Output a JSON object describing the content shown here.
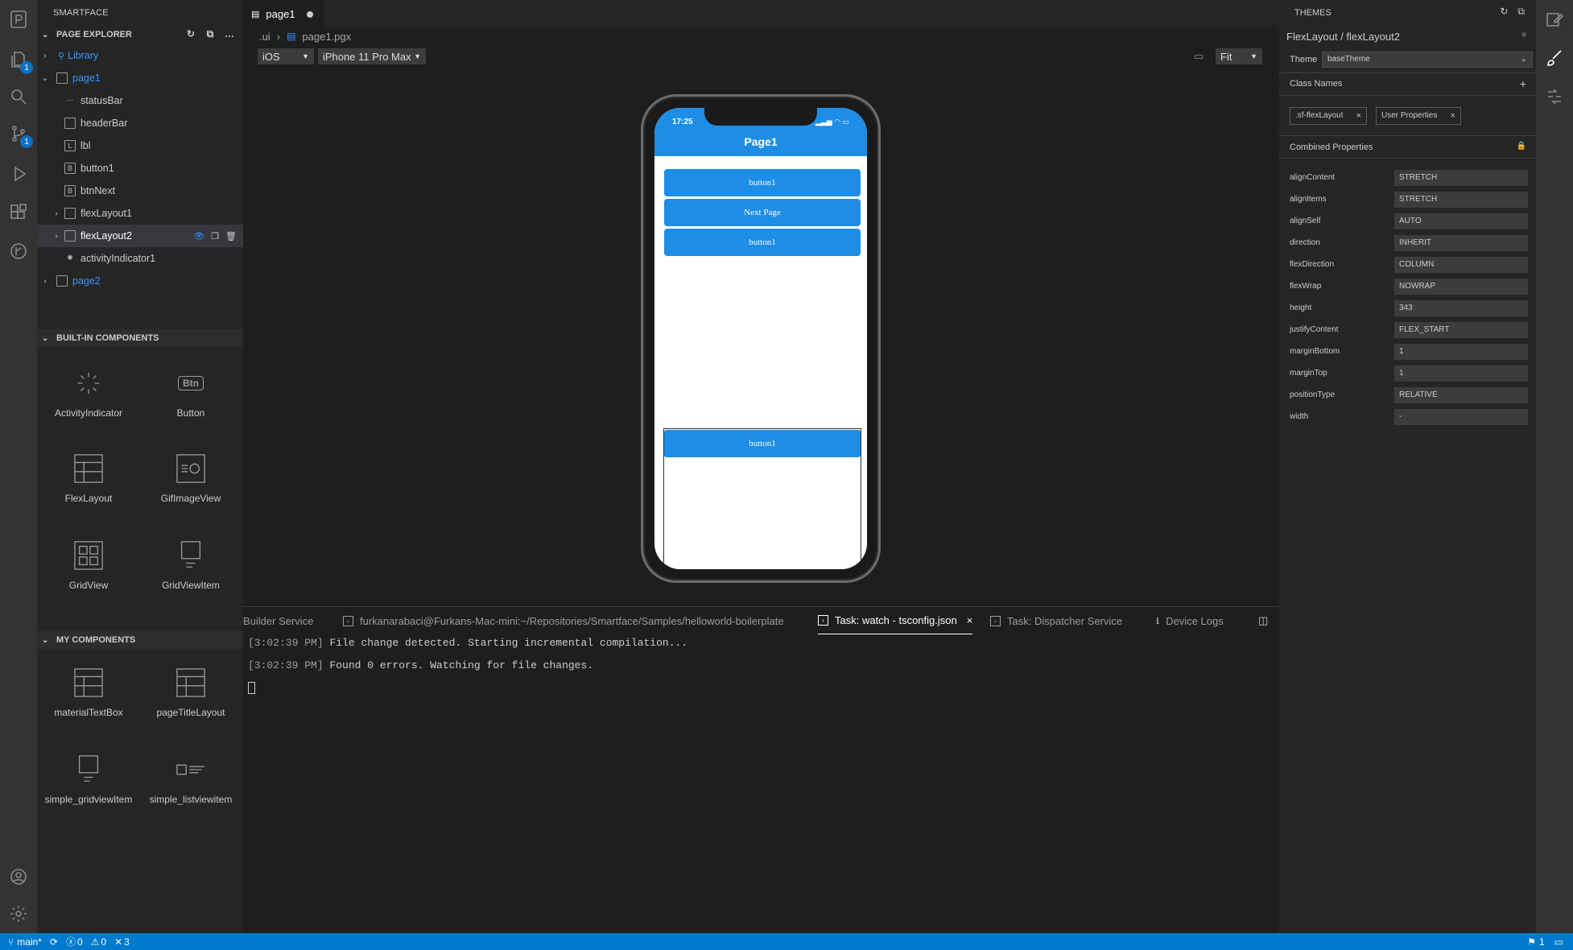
{
  "activity_bar": {
    "explorer_badge": "1",
    "scm_badge": "1"
  },
  "sidebar": {
    "title": "SMARTFACE",
    "page_explorer": {
      "header": "PAGE EXPLORER",
      "items": [
        {
          "label": "Library"
        },
        {
          "label": "page1"
        },
        {
          "label": "statusBar"
        },
        {
          "label": "headerBar"
        },
        {
          "label": "lbl"
        },
        {
          "label": "button1"
        },
        {
          "label": "btnNext"
        },
        {
          "label": "flexLayout1"
        },
        {
          "label": "flexLayout2"
        },
        {
          "label": "activityIndicator1"
        },
        {
          "label": "page2"
        }
      ]
    },
    "builtin": {
      "header": "BUILT-IN COMPONENTS",
      "items": [
        "ActivityIndicator",
        "Button",
        "FlexLayout",
        "GifImageView",
        "GridView",
        "GridViewItem"
      ],
      "btn_icon_text": "Btn"
    },
    "my_components": {
      "header": "MY COMPONENTS",
      "items": [
        "materialTextBox",
        "pageTitleLayout",
        "simple_gridviewItem",
        "simple_listviewitem"
      ]
    }
  },
  "editor": {
    "tab_label": "page1",
    "breadcrumb": [
      ".ui",
      "page1.pgx"
    ],
    "platform": "iOS",
    "device": "iPhone 11 Pro Max",
    "zoom": "Fit"
  },
  "phone": {
    "time": "17:25",
    "title": "Page1",
    "buttons": [
      "button1",
      "Next Page",
      "button1",
      "button1"
    ]
  },
  "panel": {
    "tabs": [
      "Builder Service",
      "furkanarabaci@Furkans-Mac-mini:~/Repositories/Smartface/Samples/helloworld-boilerplate",
      "Task: watch - tsconfig.json",
      "Task: Dispatcher Service",
      "Device Logs"
    ],
    "lines": [
      {
        "ts": "[3:02:39 PM]",
        "text": "File change detected. Starting incremental compilation..."
      },
      {
        "ts": "[3:02:39 PM]",
        "text": "Found 0 errors. Watching for file changes."
      }
    ]
  },
  "themes": {
    "header": "THEMES",
    "path": "FlexLayout / flexLayout2",
    "theme_label": "Theme",
    "theme_value": "baseTheme",
    "class_names_label": "Class Names",
    "chips": [
      ".sf-flexLayout",
      "User Properties"
    ],
    "combined_label": "Combined Properties",
    "properties": [
      {
        "name": "alignContent",
        "value": "STRETCH"
      },
      {
        "name": "alignItems",
        "value": "STRETCH"
      },
      {
        "name": "alignSelf",
        "value": "AUTO"
      },
      {
        "name": "direction",
        "value": "INHERIT"
      },
      {
        "name": "flexDirection",
        "value": "COLUMN"
      },
      {
        "name": "flexWrap",
        "value": "NOWRAP"
      },
      {
        "name": "height",
        "value": "343"
      },
      {
        "name": "justifyContent",
        "value": "FLEX_START"
      },
      {
        "name": "marginBottom",
        "value": "1"
      },
      {
        "name": "marginTop",
        "value": "1"
      },
      {
        "name": "positionType",
        "value": "RELATIVE"
      },
      {
        "name": "width",
        "value": "-"
      }
    ]
  },
  "statusbar": {
    "branch": "main*",
    "errors": "0",
    "warnings": "0",
    "tools": "3",
    "notifications": "1"
  },
  "colors": {
    "accent": "#007acc",
    "phone_blue": "#1e8de5",
    "link": "#3794ff"
  }
}
